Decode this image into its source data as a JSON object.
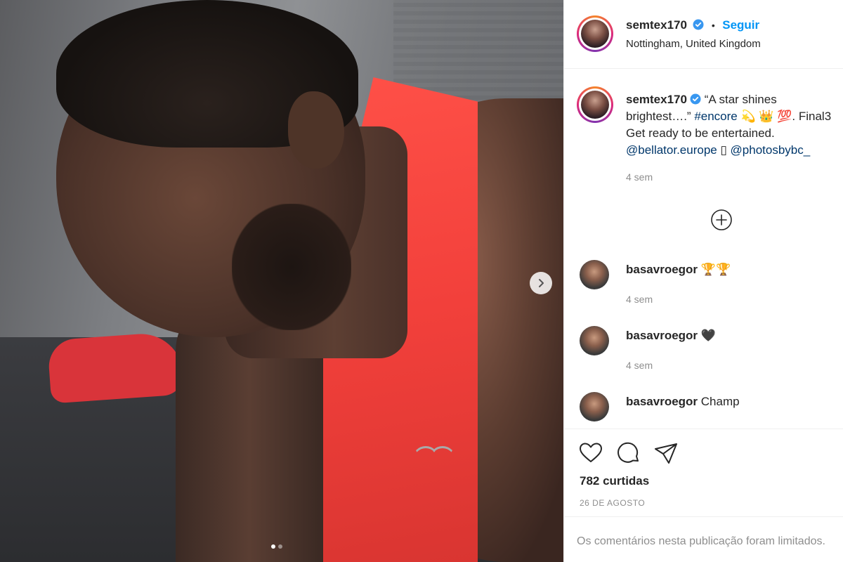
{
  "post": {
    "image_alt": "man in red tank top leaning forward",
    "carousel": {
      "current": 1,
      "total": 2
    }
  },
  "header": {
    "username": "semtex170",
    "verified_icon": "verified-badge-icon",
    "separator": "•",
    "follow_label": "Seguir",
    "location": "Nottingham, United Kingdom"
  },
  "caption": {
    "username": "semtex170",
    "text_part1": "“A star shines brightest….” ",
    "hashtag": "#encore",
    "text_part2": " 💫 👑 💯. Final3 Get ready to be entertained.",
    "mention1": "@bellator.europe",
    "mid_glyph": " ▯ ",
    "mention2": "@photosbybc_",
    "time": "4 sem"
  },
  "load_more_icon": "plus-circle-icon",
  "comments": [
    {
      "username": "basavroegor",
      "text": "🏆🏆",
      "time": "4 sem"
    },
    {
      "username": "basavroegor",
      "text": "🖤",
      "time": "4 sem"
    },
    {
      "username": "basavroegor",
      "text": "Champ",
      "time": ""
    }
  ],
  "actions": {
    "icons": [
      "heart-icon",
      "comment-icon",
      "share-icon"
    ],
    "likes": "782 curtidas",
    "date": "26 DE AGOSTO"
  },
  "footer": {
    "text": "Os comentários nesta publicação foram limitados."
  },
  "colors": {
    "accent": "#0095f6",
    "link": "#00376b",
    "muted": "#8e8e8e"
  }
}
